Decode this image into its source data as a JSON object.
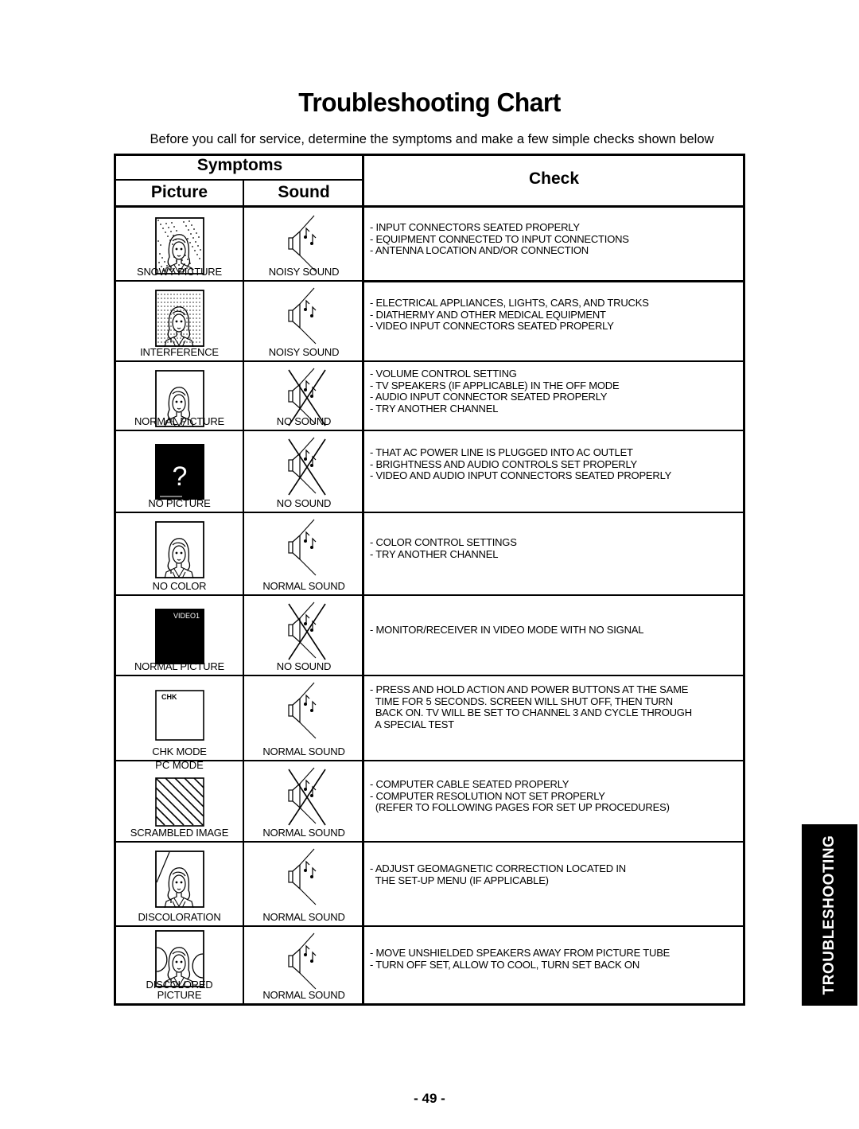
{
  "page": {
    "title": "Troubleshooting Chart",
    "subtitle": "Before you call for service, determine the symptoms and make a few simple checks shown below",
    "page_number": "- 49 -",
    "side_tab": "TROUBLESHOOTING"
  },
  "table": {
    "headers": {
      "symptoms": "Symptoms",
      "picture": "Picture",
      "sound": "Sound",
      "check": "Check"
    },
    "rows": [
      {
        "picture_label": "SNOWY PICTURE",
        "picture_icon": "snowy-picture-icon",
        "sound_label": "NOISY SOUND",
        "sound_icon": "speaker-icon",
        "checks": [
          "- INPUT CONNECTORS SEATED PROPERLY",
          "- EQUIPMENT CONNECTED TO INPUT CONNECTIONS",
          "- ANTENNA LOCATION AND/OR CONNECTION"
        ]
      },
      {
        "picture_label": "INTERFERENCE",
        "picture_icon": "interference-picture-icon",
        "sound_label": "NOISY SOUND",
        "sound_icon": "speaker-icon",
        "checks": [
          "- ELECTRICAL APPLIANCES, LIGHTS, CARS, AND TRUCKS",
          "- DIATHERMY AND OTHER MEDICAL EQUIPMENT",
          "- VIDEO INPUT CONNECTORS SEATED PROPERLY"
        ]
      },
      {
        "picture_label": "NORMAL PICTURE",
        "picture_icon": "normal-picture-icon",
        "sound_label": "NO SOUND",
        "sound_icon": "speaker-crossed-icon",
        "checks": [
          "- VOLUME CONTROL SETTING",
          "- TV SPEAKERS (IF APPLICABLE) IN THE OFF MODE",
          "- AUDIO INPUT CONNECTOR SEATED PROPERLY",
          "- TRY ANOTHER CHANNEL"
        ]
      },
      {
        "picture_label": "NO PICTURE",
        "picture_icon": "no-picture-icon",
        "picture_icon_text": "?",
        "sound_label": "NO SOUND",
        "sound_icon": "speaker-crossed-icon",
        "checks": [
          "- THAT AC POWER LINE IS PLUGGED INTO AC OUTLET",
          "- BRIGHTNESS AND AUDIO CONTROLS SET PROPERLY",
          "- VIDEO AND AUDIO INPUT CONNECTORS SEATED PROPERLY"
        ]
      },
      {
        "picture_label": "NO COLOR",
        "picture_icon": "normal-picture-icon",
        "sound_label": "NORMAL SOUND",
        "sound_icon": "speaker-icon",
        "checks": [
          "- COLOR CONTROL SETTINGS",
          "- TRY ANOTHER CHANNEL"
        ]
      },
      {
        "picture_label": "NORMAL PICTURE",
        "picture_icon": "video-screen-icon",
        "picture_icon_text": "VIDEO1",
        "sound_label": "NO SOUND",
        "sound_icon": "speaker-crossed-icon",
        "checks": [
          "- MONITOR/RECEIVER IN VIDEO MODE WITH NO SIGNAL"
        ]
      },
      {
        "picture_label": "CHK MODE",
        "picture_icon": "chk-screen-icon",
        "picture_icon_text": "CHK",
        "sound_label": "NORMAL SOUND",
        "sound_icon": "speaker-icon",
        "checks": [
          "- PRESS AND HOLD ACTION AND POWER BUTTONS AT THE SAME",
          "  TIME FOR 5 SECONDS. SCREEN WILL SHUT OFF, THEN TURN",
          "  BACK ON. TV WILL BE SET TO CHANNEL 3 AND CYCLE THROUGH",
          "  A SPECIAL TEST"
        ]
      },
      {
        "picture_sublabel": "PC MODE",
        "picture_label": "SCRAMBLED IMAGE",
        "picture_icon": "scrambled-image-icon",
        "sound_label": "NORMAL SOUND",
        "sound_icon": "speaker-crossed-icon",
        "checks": [
          "- COMPUTER CABLE SEATED PROPERLY",
          "- COMPUTER RESOLUTION NOT SET PROPERLY",
          "  (REFER TO FOLLOWING PAGES FOR SET UP PROCEDURES)"
        ]
      },
      {
        "picture_label": "DISCOLORATION",
        "picture_icon": "discoloration-picture-icon",
        "sound_label": "NORMAL SOUND",
        "sound_icon": "speaker-icon",
        "checks": [
          "- ADJUST GEOMAGNETIC CORRECTION LOCATED IN",
          "  THE SET-UP MENU (IF APPLICABLE)"
        ]
      },
      {
        "picture_label": "DISCOLORED\nPICTURE",
        "picture_label_lines": [
          "DISCOLORED",
          "PICTURE"
        ],
        "picture_icon": "discolored-picture-icon",
        "sound_label": "NORMAL SOUND",
        "sound_icon": "speaker-icon",
        "checks": [
          "- MOVE UNSHIELDED SPEAKERS AWAY FROM PICTURE TUBE",
          "- TURN OFF SET, ALLOW TO COOL, TURN SET BACK ON"
        ]
      }
    ]
  }
}
